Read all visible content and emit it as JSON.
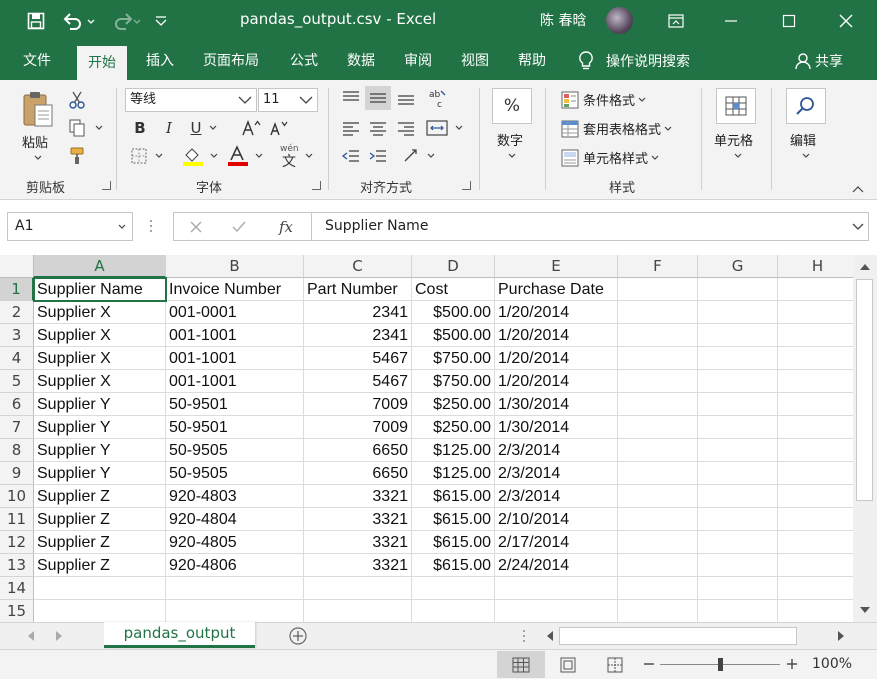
{
  "titlebar": {
    "title": "pandas_output.csv  -  Excel",
    "user": "陈 春晗",
    "icons": [
      "save-icon",
      "undo-icon",
      "redo-icon",
      "customize-qat-icon",
      "ribbon-display-icon",
      "minimize-icon",
      "maximize-icon",
      "close-icon"
    ]
  },
  "tabs": [
    "文件",
    "开始",
    "插入",
    "页面布局",
    "公式",
    "数据",
    "审阅",
    "视图",
    "帮助"
  ],
  "active_tab": "开始",
  "tell_me": "操作说明搜索",
  "share": "共享",
  "ribbon": {
    "clipboard": {
      "paste": "粘贴",
      "label": "剪贴板"
    },
    "font": {
      "name": "等线",
      "size": "11",
      "bold": "B",
      "italic": "I",
      "underline": "U",
      "label": "字体"
    },
    "alignment": {
      "label": "对齐方式"
    },
    "number": {
      "percent": "%",
      "label_btn": "数字"
    },
    "styles": {
      "conditional": "条件格式",
      "table": "套用表格格式",
      "cell_styles": "单元格样式",
      "label": "样式"
    },
    "cells": {
      "label": "单元格"
    },
    "editing": {
      "label": "编辑"
    }
  },
  "formula_bar": {
    "name_box": "A1",
    "fx": "fx",
    "value": "Supplier Name"
  },
  "grid": {
    "columns": [
      "A",
      "B",
      "C",
      "D",
      "E",
      "F",
      "G",
      "H"
    ],
    "rows": [
      "1",
      "2",
      "3",
      "4",
      "5",
      "6",
      "7",
      "8",
      "9",
      "10",
      "11",
      "12",
      "13",
      "14",
      "15"
    ],
    "data": [
      [
        "Supplier Name",
        "Invoice Number",
        "Part Number",
        "Cost",
        "Purchase Date"
      ],
      [
        "Supplier X",
        "001-0001",
        "2341",
        "$500.00",
        "1/20/2014"
      ],
      [
        "Supplier X",
        "001-1001",
        "2341",
        "$500.00",
        "1/20/2014"
      ],
      [
        "Supplier X",
        "001-1001",
        "5467",
        "$750.00",
        "1/20/2014"
      ],
      [
        "Supplier X",
        "001-1001",
        "5467",
        "$750.00",
        "1/20/2014"
      ],
      [
        "Supplier Y",
        "50-9501",
        "7009",
        "$250.00",
        "1/30/2014"
      ],
      [
        "Supplier Y",
        "50-9501",
        "7009",
        "$250.00",
        "1/30/2014"
      ],
      [
        "Supplier Y",
        "50-9505",
        "6650",
        "$125.00",
        "2/3/2014"
      ],
      [
        "Supplier Y",
        "50-9505",
        "6650",
        "$125.00",
        "2/3/2014"
      ],
      [
        "Supplier Z",
        "920-4803",
        "3321",
        "$615.00",
        "2/3/2014"
      ],
      [
        "Supplier Z",
        "920-4804",
        "3321",
        "$615.00",
        "2/10/2014"
      ],
      [
        "Supplier Z",
        "920-4805",
        "3321",
        "$615.00",
        "2/17/2014"
      ],
      [
        "Supplier Z",
        "920-4806",
        "3321",
        "$615.00",
        "2/24/2014"
      ]
    ],
    "active_cell": "A1"
  },
  "sheet_tab": "pandas_output",
  "status": {
    "zoom": "100%"
  },
  "colors": {
    "accent": "#217346",
    "ribbon_bg": "#f3f3f3",
    "font_color_red": "#e00000",
    "highlight_yellow": "#ffff00"
  }
}
